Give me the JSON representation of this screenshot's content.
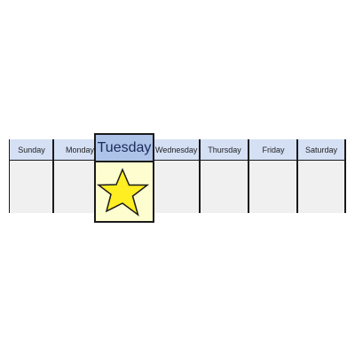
{
  "days": [
    {
      "label": "Sunday"
    },
    {
      "label": "Monday"
    },
    {
      "label": "Tuesday"
    },
    {
      "label": "Wednesday"
    },
    {
      "label": "Thursday"
    },
    {
      "label": "Friday"
    },
    {
      "label": "Saturday"
    }
  ],
  "highlighted_day": "Tuesday",
  "colors": {
    "header": "#d5e0f5",
    "highlight_header": "#aec3e8",
    "highlight_cell": "#fefdd0",
    "cell": "#f0f0f0",
    "star_fill": "#ffee22"
  },
  "icons": {
    "highlight_marker": "star-icon"
  }
}
